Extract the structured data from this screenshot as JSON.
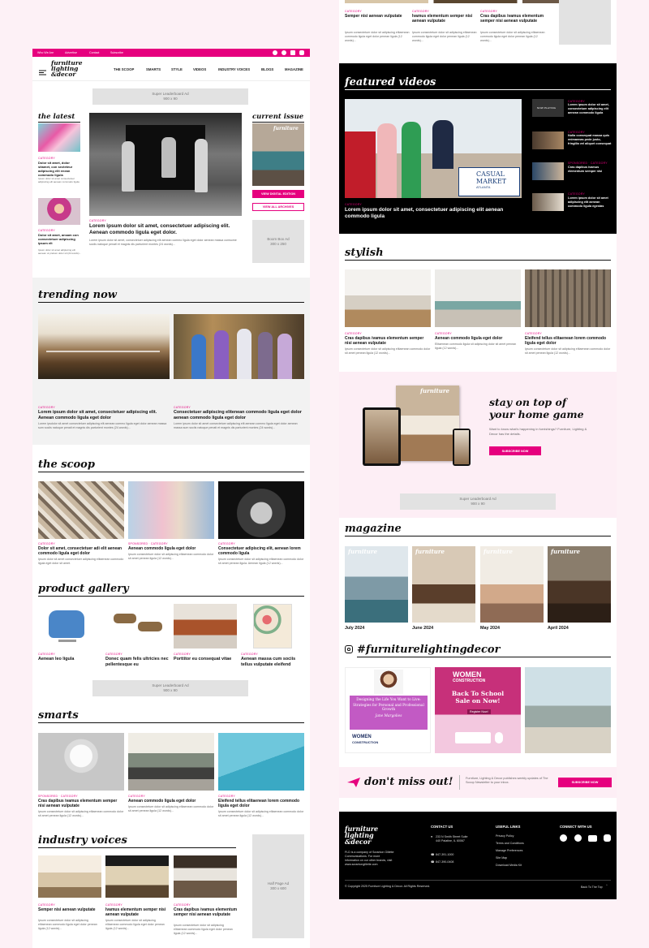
{
  "topbar": {
    "links": [
      "Who We Are",
      "Advertise",
      "Contact",
      "Subscribe"
    ]
  },
  "brand": {
    "line1": "furniture",
    "line2": "lighting",
    "line3": "&decor"
  },
  "nav": {
    "items": [
      "THE SCOOP",
      "SMARTS",
      "STYLE",
      "VIDEOS",
      "INDUSTRY VOICES",
      "BLOGS",
      "MAGAZINE"
    ]
  },
  "ads": {
    "super_leaderboard": "Super Leaderboard Ad",
    "super_size": "900 x 90",
    "boom_box": "Boom Box Ad",
    "boom_size": "300 x 250",
    "half_page": "Half Page Ad",
    "half_size": "300 x 600"
  },
  "latest": {
    "title": "the latest",
    "items": [
      {
        "cat": "CATEGORY",
        "head": "Dolor sit amet, dolor sitamet, con secteteur adipiscing elit enean commodo ligula",
        "ex": "Ipsum dolor sit amet consectetuer adipiscing elit aenean commodo ligula"
      },
      {
        "cat": "CATEGORY",
        "head": "Dolor sit amet, ansam con consectetuer adipiscing ipsum elt",
        "ex": "Ipsum dolor sit amet adipiscing elit aenean ut pretium dolor sit (24 words)..."
      }
    ]
  },
  "feature": {
    "cat": "CATEGORY",
    "head": "Lorem ipsum dolor sit amet, consectetuer adipiscing elit. Aenean commodo ligula eget dolor.",
    "ex": "Lorem ipsum dolor sit amet, consectetuer adipiscing elit aenean commo ligula eget dolor aenean massa cumsome sociis natoque penatl et magnis dis parturient montes (24 words)..."
  },
  "current_issue": {
    "title": "current issue",
    "btn_digital": "VIEW DIGITAL EDITION",
    "btn_archives": "VIEW ALL ARCHIVES"
  },
  "trending": {
    "title": "trending now",
    "items": [
      {
        "cat": "CATEGORY",
        "head": "Lorem ipsum dolor sit amet, consectetuer adipiscing elit. Aenean commodo ligula eget dolor",
        "ex": "Lorem ipsdolor sit amet consectetuer adipiscing elit aenean commo ligula eget dolor aenean massa sum sociis natoque penati et magnis dis parturient montes (24 words)..."
      },
      {
        "cat": "CATEGORY",
        "head": "Consectetuer adipiscing elitenean commodo ligula eget dolor aenean commodo ligula eget dolor",
        "ex": "Lorem ipsum dolor sit amet consectetuer adipiscing elit aenean commo ligula eget dolor aenean massa sum sociis natoque penati et magnis dis parturient montes (24 words)..."
      }
    ]
  },
  "scoop": {
    "title": "the scoop",
    "items": [
      {
        "cat": "CATEGORY",
        "head": "Dolor sit amet, consectetuer adi elit aenean commodo ligula eget dolor",
        "ex": "Ipsum dolor sit amet consectetuer adipiscing elitaenean commodo ligula eget dolor sit amet."
      },
      {
        "cat": "SPONSORED · CATEGORY",
        "head": "Aenean commodo ligula eget dolor",
        "ex": "Ipsum consectetuer dolor sit adipiscing elitaenean commodo dolor sit amet penean ligula (12 words)..."
      },
      {
        "cat": "CATEGORY",
        "head": "Consectetuer adipiscing elit, aenean lorem commodo ligula",
        "ex": "Ipsum consectetuer dolor sit adipiscing elitaenean commodo dolor sit amet penean ligula. Aenean ligula (12 words)..."
      }
    ]
  },
  "gallery": {
    "title": "product gallery",
    "items": [
      {
        "cat": "CATEGORY",
        "head": "Aenean leo ligula"
      },
      {
        "cat": "CATEGORY",
        "head": "Donec quam felis ultricies nec pellentesque eu"
      },
      {
        "cat": "CATEGORY",
        "head": "Porttitor eu consequat vitae"
      },
      {
        "cat": "CATEGORY",
        "head": "Aenean massa cum sociis tellus vulputate eleifend"
      }
    ]
  },
  "smarts": {
    "title": "smarts",
    "items": [
      {
        "cat": "SPONSORED · CATEGORY",
        "head": "Cras dapibus ivamus elementum semper nisi aenean vulputate",
        "ex": "Ipsum consectetuer dolor sit adipiscing elitaenean commodo dolor sit amet penean ligula (12 words)..."
      },
      {
        "cat": "CATEGORY",
        "head": "Aenean commodo ligula eget dolor",
        "ex": "Ipsum consectetuer dolor sit adipiscing elitaenean commodo dolor sit amet penean ligula (12 words)..."
      },
      {
        "cat": "CATEGORY",
        "head": "Eleifend tellus  elitaenean lorem commodo ligula eget dolor",
        "ex": "Ipsum consectetuer dolor sit adipiscing elitaenean commodo dolor sit amet penean ligula (12 words)..."
      }
    ]
  },
  "voices": {
    "title": "industry voices",
    "items": [
      {
        "cat": "CATEGORY",
        "head": "Semper nisi aenean vulputate",
        "ex": "Ipsum consectetuer dolor sit adipiscing elitaenean commodo ligula eget dolor penean ligula (12 words)..."
      },
      {
        "cat": "CATEGORY",
        "head": "Ivamus elementum semper nisi aenean vulputate",
        "ex": "Ipsum consectetuer dolor sit adipiscing elitaenean commodo ligula eget dolor penean ligula (12 words)..."
      },
      {
        "cat": "CATEGORY",
        "head": "Cras dapibus ivamus elementum semper nisi aenean vulputate",
        "ex": "Ipsum consectetuer dolor sit adipiscing elitaenean commodo ligula eget dolor penean ligula (12 words)..."
      }
    ]
  },
  "videos": {
    "title": "featured videos",
    "main_cat": "CATEGORY",
    "main_head": "Lorem ipsum dolor sit amet, consectetuer adipiscing elit aenean commodo ligula",
    "sign1": "CASUAL",
    "sign2": "MARKET",
    "sign3": "ATLANTA",
    "side": [
      {
        "cat": "NOW PLAYING",
        "head": "Lorem ipsum dolor sit amet, consectetuer adipiscing elit aenean commodo ligula"
      },
      {
        "cat": "CATEGORY",
        "head": "Nulla consequat massa quis enimaenas pede justo, fringilla vel aliquet consequat"
      },
      {
        "cat": "SPONSORED · CATEGORY",
        "head": "Cras dapibus ivamus elementum semper nisi"
      },
      {
        "cat": "CATEGORY",
        "head": "Lorem ipsum dolor sit amet adipiscing elit aenean commodo ligula egestas"
      }
    ]
  },
  "stylish": {
    "title": "stylish",
    "items": [
      {
        "cat": "CATEGORY",
        "head": "Cras dapibus ivamus elementum semper nisi aenean vulputate",
        "ex": "Ipsum consectetuer dolor sit adipiscing elitaenean commodo dolor sit amet penean ligula (12 words)..."
      },
      {
        "cat": "CATEGORY",
        "head": "Aenean commodo ligula eget dolor",
        "ex": "Elitaenean commodo ligula sit adipiscing dolor sit amet penean ligula (12 words)..."
      },
      {
        "cat": "CATEGORY",
        "head": "Eleifend tellus  elitaenean lorem commodo ligula eget dolor",
        "ex": "Ipsum consectetuer dolor sit adipiscing elitaenean commodo dolor sit amet penean ligula (12 words)..."
      }
    ]
  },
  "top_items": [
    {
      "cat": "CATEGORY",
      "head": "Semper nisi aenean vulputate",
      "ex": "Ipsum consectetuer dolor sit adipiscing elitaenean commodo ligula eget dolor penean ligula (12 words)..."
    },
    {
      "cat": "CATEGORY",
      "head": "Ivamus elementum semper nisi aenean vulputate",
      "ex": "Ipsum consectetuer dolor sit adipiscing elitaenean commodo ligula eget dolor penean ligula (12 words)..."
    },
    {
      "cat": "CATEGORY",
      "head": "Cras dapibus ivamus elementum semper nisi aenean vulputate",
      "ex": "Ipsum consectetuer dolor sit adipiscing elitaenean commodo ligula eget dolor penean ligula (12 words)..."
    }
  ],
  "promo": {
    "line1": "stay on top of",
    "line2": "your home game",
    "text": "Want to know what's happening in furnishings? Furniture, Lighting & Decor has the details.",
    "btn": "SUBSCRIBE NOW"
  },
  "magazine": {
    "title": "magazine",
    "issues": [
      "July 2024",
      "June 2024",
      "May 2024",
      "April 2024"
    ]
  },
  "instagram": {
    "title": "#furniturelightingdecor",
    "post1_a": "Designing the Life You Want to Live:",
    "post1_b": "Strategies for Personal and Professional Growth",
    "post1_c": "Jane Margolies",
    "post2_a": "WOMEN",
    "post2_b": "CONSTRUCTION",
    "post2_c": "Back To School Sale on Now!",
    "post2_d": "Register Now!"
  },
  "newsletter": {
    "title": "don't miss out!",
    "text": "Furniture, Lighting & Decor publishes weekly updates of The Scoop Newsletter to your inbox.",
    "btn": "SUBSCRIBE NOW"
  },
  "footer": {
    "about": "FLD is a company of Scranton Gillette Communications. For more information on our other brands, visit www.scrantongillette.com",
    "contact_title": "CONTACT US",
    "address": "233 N Smith Street Suite 440 Palatine, IL 60067",
    "phone1": "847-391-1000",
    "phone2": "847-390-0408",
    "links_title": "USEFUL LINKS",
    "links": [
      "Privacy Policy",
      "Terms and Conditions",
      "Manage Preferences",
      "Site Map",
      "Download Media Kit"
    ],
    "social_title": "CONNECT WITH US",
    "copyright": "© Copyright 2025 Furniture Lighting & Decor. All Rights Reserved.",
    "back_top": "Back To The Top"
  },
  "colors": {
    "accent": "#e6007e",
    "page_bg": "#fdf1f6",
    "dark": "#000000"
  }
}
